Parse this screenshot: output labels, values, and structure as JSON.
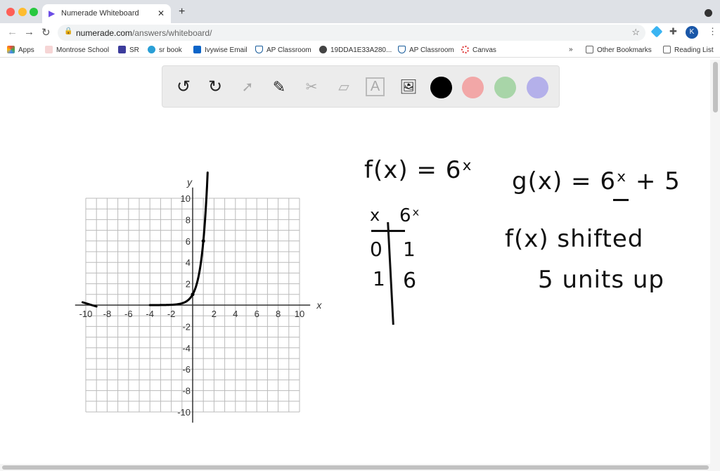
{
  "browser": {
    "tab_title": "Numerade Whiteboard",
    "url_host": "numerade.com",
    "url_path": "/answers/whiteboard/",
    "profile_initial": "K",
    "bookmarks": [
      "Apps",
      "Montrose School",
      "SR",
      "sr book",
      "Ivywise Email",
      "AP Classroom",
      "19DDA1E33A280...",
      "AP Classroom",
      "Canvas"
    ],
    "overflow": "»",
    "other_bookmarks": "Other Bookmarks",
    "reading_list": "Reading List"
  },
  "toolbar": {
    "tools": [
      "undo-icon",
      "redo-icon",
      "select-icon",
      "pen-icon",
      "tools-icon",
      "eraser-icon",
      "text-icon",
      "image-icon"
    ],
    "colors": [
      "#000000",
      "#f2a7a7",
      "#a8d5a8",
      "#b4b0ea"
    ]
  },
  "graph": {
    "x_label": "x",
    "y_label": "y",
    "x_ticks": [
      "-10",
      "-8",
      "-6",
      "-4",
      "-2",
      "2",
      "4",
      "6",
      "8",
      "10"
    ],
    "y_ticks": [
      "10",
      "8",
      "6",
      "4",
      "2",
      "-2",
      "-4",
      "-6",
      "-8",
      "-10"
    ],
    "xlim": [
      -10,
      10
    ],
    "ylim": [
      -10,
      10
    ]
  },
  "notes": {
    "f_def": "f(x) = 6ˣ",
    "g_def": "g(x) = 6ˣ + 5",
    "table_x": "x",
    "table_fx": "6ˣ",
    "row1": [
      "0",
      "1"
    ],
    "row2": [
      "1",
      "6"
    ],
    "line1": "f(x) shifted",
    "line2": "5 units up"
  }
}
